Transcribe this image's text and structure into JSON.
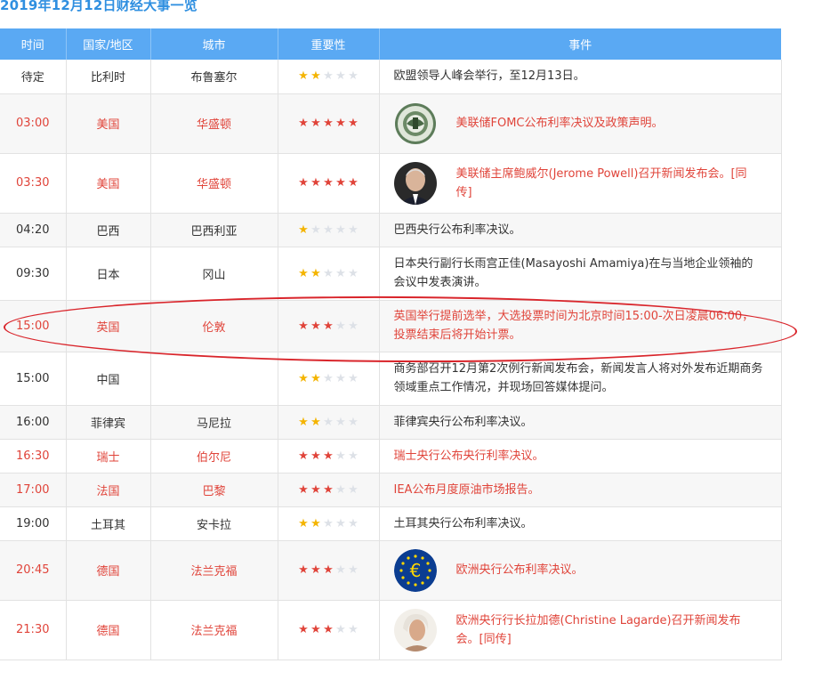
{
  "title": "2019年12月12日财经大事一览",
  "headers": {
    "time": "时间",
    "country": "国家/地区",
    "city": "城市",
    "importance": "重要性",
    "event": "事件"
  },
  "colors": {
    "header_bg": "#5aa9f3",
    "highlight_text": "#e0443a",
    "star_yellow": "#f4b400",
    "star_red": "#e0443a",
    "star_empty": "#dde1e7",
    "annotation_ellipse": "#d9252b"
  },
  "rows": [
    {
      "time": "待定",
      "country": "比利时",
      "city": "布鲁塞尔",
      "stars": 2,
      "highlight": false,
      "event": "欧盟领导人峰会举行，至12月13日。",
      "icon": null
    },
    {
      "time": "03:00",
      "country": "美国",
      "city": "华盛顿",
      "stars": 5,
      "highlight": true,
      "event": "美联储FOMC公布利率决议及政策声明。",
      "icon": "federal-reserve-seal-icon"
    },
    {
      "time": "03:30",
      "country": "美国",
      "city": "华盛顿",
      "stars": 5,
      "highlight": true,
      "event": "美联储主席鲍威尔(Jerome Powell)召开新闻发布会。[同传]",
      "icon": "powell-portrait-icon"
    },
    {
      "time": "04:20",
      "country": "巴西",
      "city": "巴西利亚",
      "stars": 1,
      "highlight": false,
      "event": "巴西央行公布利率决议。",
      "icon": null
    },
    {
      "time": "09:30",
      "country": "日本",
      "city": "冈山",
      "stars": 2,
      "highlight": false,
      "event": "日本央行副行长雨宫正佳(Masayoshi Amamiya)在与当地企业领袖的会议中发表演讲。",
      "icon": null
    },
    {
      "time": "15:00",
      "country": "英国",
      "city": "伦敦",
      "stars": 3,
      "highlight": true,
      "event": "英国举行提前选举，大选投票时间为北京时间15:00-次日凌晨06:00，投票结束后将开始计票。",
      "icon": null
    },
    {
      "time": "15:00",
      "country": "中国",
      "city": "",
      "stars": 2,
      "highlight": false,
      "event": "商务部召开12月第2次例行新闻发布会，新闻发言人将对外发布近期商务领域重点工作情况，并现场回答媒体提问。",
      "icon": null
    },
    {
      "time": "16:00",
      "country": "菲律宾",
      "city": "马尼拉",
      "stars": 2,
      "highlight": false,
      "event": "菲律宾央行公布利率决议。",
      "icon": null
    },
    {
      "time": "16:30",
      "country": "瑞士",
      "city": "伯尔尼",
      "stars": 3,
      "highlight": true,
      "event": "瑞士央行公布央行利率决议。",
      "icon": null
    },
    {
      "time": "17:00",
      "country": "法国",
      "city": "巴黎",
      "stars": 3,
      "highlight": true,
      "event": "IEA公布月度原油市场报告。",
      "icon": null
    },
    {
      "time": "19:00",
      "country": "土耳其",
      "city": "安卡拉",
      "stars": 2,
      "highlight": false,
      "event": "土耳其央行公布利率决议。",
      "icon": null
    },
    {
      "time": "20:45",
      "country": "德国",
      "city": "法兰克福",
      "stars": 3,
      "highlight": true,
      "event": "欧洲央行公布利率决议。",
      "icon": "euro-logo-icon"
    },
    {
      "time": "21:30",
      "country": "德国",
      "city": "法兰克福",
      "stars": 3,
      "highlight": true,
      "event": "欧洲央行行长拉加德(Christine Lagarde)召开新闻发布会。[同传]",
      "icon": "lagarde-portrait-icon"
    }
  ]
}
